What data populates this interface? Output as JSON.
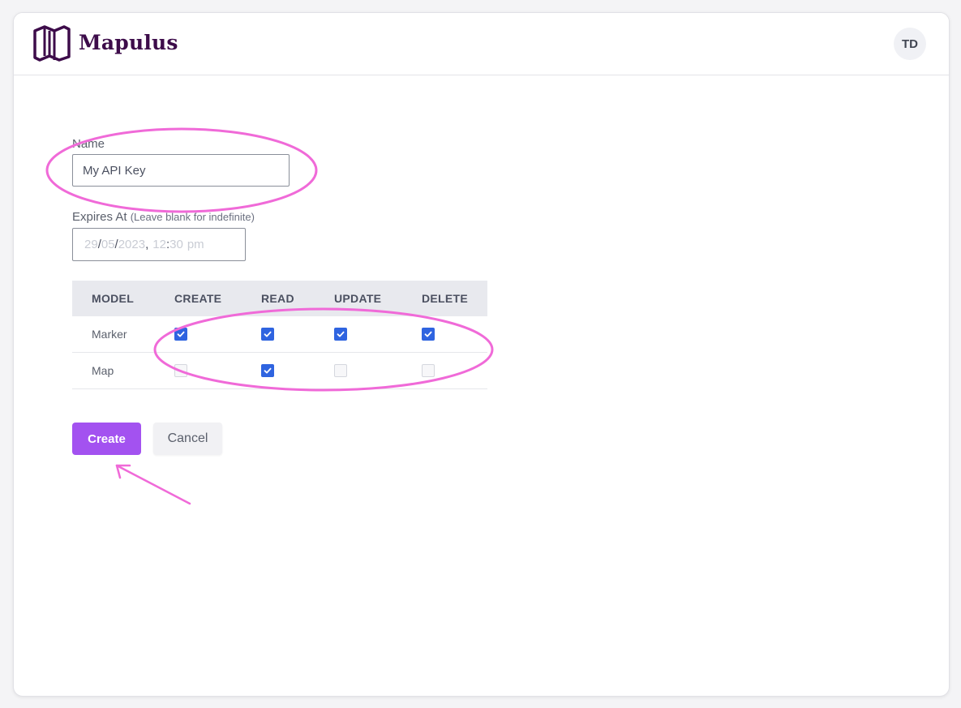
{
  "app": {
    "brand": "Mapulus",
    "avatar_initials": "TD",
    "accent": "#a352f0",
    "brand_color": "#3d0c4a"
  },
  "form": {
    "name_label": "Name",
    "name_value": "My API Key",
    "expires_label": "Expires At",
    "expires_hint": "(Leave blank for indefinite)",
    "expires": {
      "day": "29",
      "month": "05",
      "year": "2023",
      "hour": "12",
      "minute": "30",
      "ampm": "pm"
    }
  },
  "permissions": {
    "headers": [
      "MODEL",
      "CREATE",
      "READ",
      "UPDATE",
      "DELETE"
    ],
    "rows": [
      {
        "model": "Marker",
        "create": true,
        "read": true,
        "update": true,
        "delete": true
      },
      {
        "model": "Map",
        "create": false,
        "read": true,
        "update": false,
        "delete": false
      }
    ]
  },
  "actions": {
    "create_label": "Create",
    "cancel_label": "Cancel"
  },
  "annotation_color": "#f06ad8"
}
